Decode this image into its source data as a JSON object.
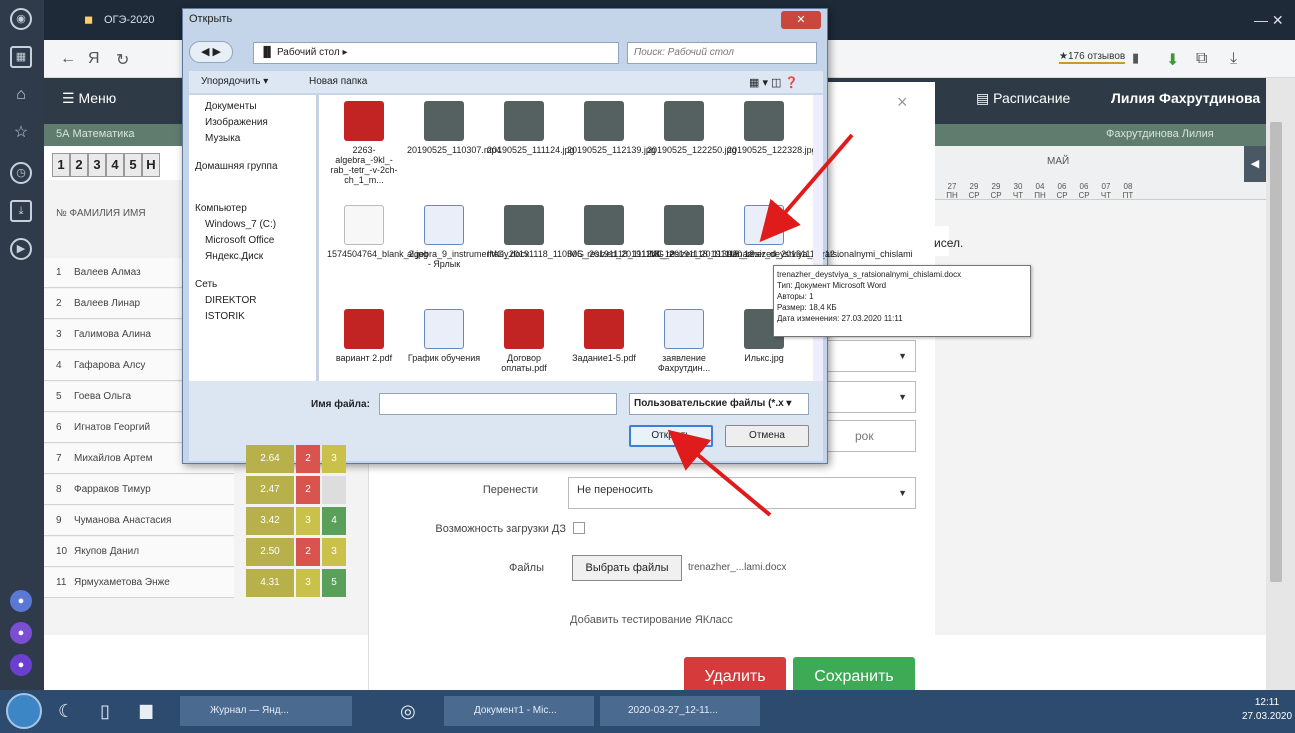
{
  "browser": {
    "tab_title": "ОГЭ-2020",
    "url_text": "Я",
    "reviews": "★176 отзывов"
  },
  "page": {
    "menu": "Меню",
    "schedule": "Расписание",
    "user": "Лилия Фахрутдинова",
    "class_bar": "5А Математика",
    "teacher_bar": "Фахрутдинова Лилия",
    "tabs": [
      "1",
      "2",
      "3",
      "4",
      "5",
      "Н"
    ],
    "col_header": "№  ФАМИЛИЯ ИМЯ",
    "month": "МАЙ",
    "days": [
      "27\nПН",
      "29\nСР",
      "29\nСР",
      "30\nЧТ",
      "04\nПН",
      "06\nСР",
      "06\nСР",
      "07\nЧТ",
      "08\nПТ"
    ],
    "students": [
      {
        "no": "1",
        "name": "Валеев Алмаз"
      },
      {
        "no": "2",
        "name": "Валеев Линар"
      },
      {
        "no": "3",
        "name": "Галимова Алина"
      },
      {
        "no": "4",
        "name": "Гафарова Алсу"
      },
      {
        "no": "5",
        "name": "Гоева Ольга"
      },
      {
        "no": "6",
        "name": "Игнатов Георгий"
      },
      {
        "no": "7",
        "name": "Михайлов Артем",
        "avg": "2.64",
        "m1": "2",
        "m2": "3"
      },
      {
        "no": "8",
        "name": "Фарраков Тимур",
        "avg": "2.47",
        "m1": "2",
        "m2": ""
      },
      {
        "no": "9",
        "name": "Чуманова Анастасия",
        "avg": "3.42",
        "m1": "3",
        "m2": "4"
      },
      {
        "no": "10",
        "name": "Якупов Данил",
        "avg": "2.50",
        "m1": "2",
        "m2": "3"
      },
      {
        "no": "11",
        "name": "Ярмухаметова Энже",
        "avg": "4.31",
        "m1": "3",
        "m2": "5"
      }
    ]
  },
  "modal": {
    "close": "×",
    "partial_text": "исел.",
    "partial_text2": "рок",
    "transfer_label": "Перенести",
    "transfer_value": "Не переносить",
    "upload_label": "Возможность загрузки ДЗ",
    "files_label": "Файлы",
    "choose_files": "Выбрать файлы",
    "chosen_file": "trenazher_...lami.docx",
    "add_test": "Добавить тестирование ЯКласс",
    "delete": "Удалить",
    "save": "Сохранить"
  },
  "dialog": {
    "title": "Открыть",
    "close": "✕",
    "path": "▐▌ Рабочий стол ▸",
    "search_placeholder": "Поиск: Рабочий стол",
    "organize": "Упорядочить ▾",
    "new_folder": "Новая папка",
    "tree": [
      "Документы",
      "Изображения",
      "Музыка",
      "Домашняя группа",
      "Компьютер",
      "Windows_7 (C:)",
      "Microsoft Office",
      "Яндекс.Диск",
      "Сеть",
      "DIREKTOR",
      "ISTORIK"
    ],
    "files": [
      {
        "name": "2263-algebra_-9kl_-rab_-tetr_-v-2ch-ch_1_m...",
        "type": "pdf"
      },
      {
        "name": "20190525_110307.mp4",
        "type": "img"
      },
      {
        "name": "20190525_111124.jpg",
        "type": "img"
      },
      {
        "name": "20190525_112139.jpg",
        "type": "img"
      },
      {
        "name": "20190525_122250.jpg",
        "type": "img"
      },
      {
        "name": "20190525_122328.jpg",
        "type": "img"
      },
      {
        "name": "1574504764_blank_2.jpg",
        "type": "blank"
      },
      {
        "name": "algebra_9_instrumentariy.docx - Ярлык",
        "type": "doc"
      },
      {
        "name": "IMG_20191118_110505_resized_20191118_12...",
        "type": "img"
      },
      {
        "name": "IMG_20191118_111240_resized_20191118_12...",
        "type": "img"
      },
      {
        "name": "IMG_20191118_113930_resized_20191118_12...",
        "type": "img"
      },
      {
        "name": "trenazher_deystviya_s_ratsionalnymi_chislami",
        "type": "doc"
      },
      {
        "name": "вариант 2.pdf",
        "type": "pdf"
      },
      {
        "name": "График обучения",
        "type": "doc"
      },
      {
        "name": "Договор оплаты.pdf",
        "type": "pdf"
      },
      {
        "name": "Задание1-5.pdf",
        "type": "pdf"
      },
      {
        "name": "заявление Фахрутдин...",
        "type": "doc"
      },
      {
        "name": "Илькс.jpg",
        "type": "img"
      }
    ],
    "filename_label": "Имя файла:",
    "filename_value": "",
    "filetype": "Пользовательские файлы (*.x ▾",
    "open": "Открыть",
    "cancel": "Отмена",
    "tooltip": [
      "trenazher_deystviya_s_ratsionalnymi_chislami.docx",
      "Тип: Документ Microsoft Word",
      "Авторы: 1",
      "Размер: 18,4 КБ",
      "Дата изменения: 27.03.2020 11:11"
    ]
  },
  "taskbar": {
    "items": [
      "Журнал — Янд...",
      "Документ1 - Mic...",
      "2020-03-27_12-11..."
    ],
    "time": "12:11",
    "date": "27.03.2020"
  },
  "colors": {
    "arrow": "#e01b1b",
    "mark2": "#d9534f",
    "mark3": "#c9c14a",
    "mark4": "#5aa05a",
    "mark5": "#5aa05a",
    "avg": "#b8b04a"
  }
}
